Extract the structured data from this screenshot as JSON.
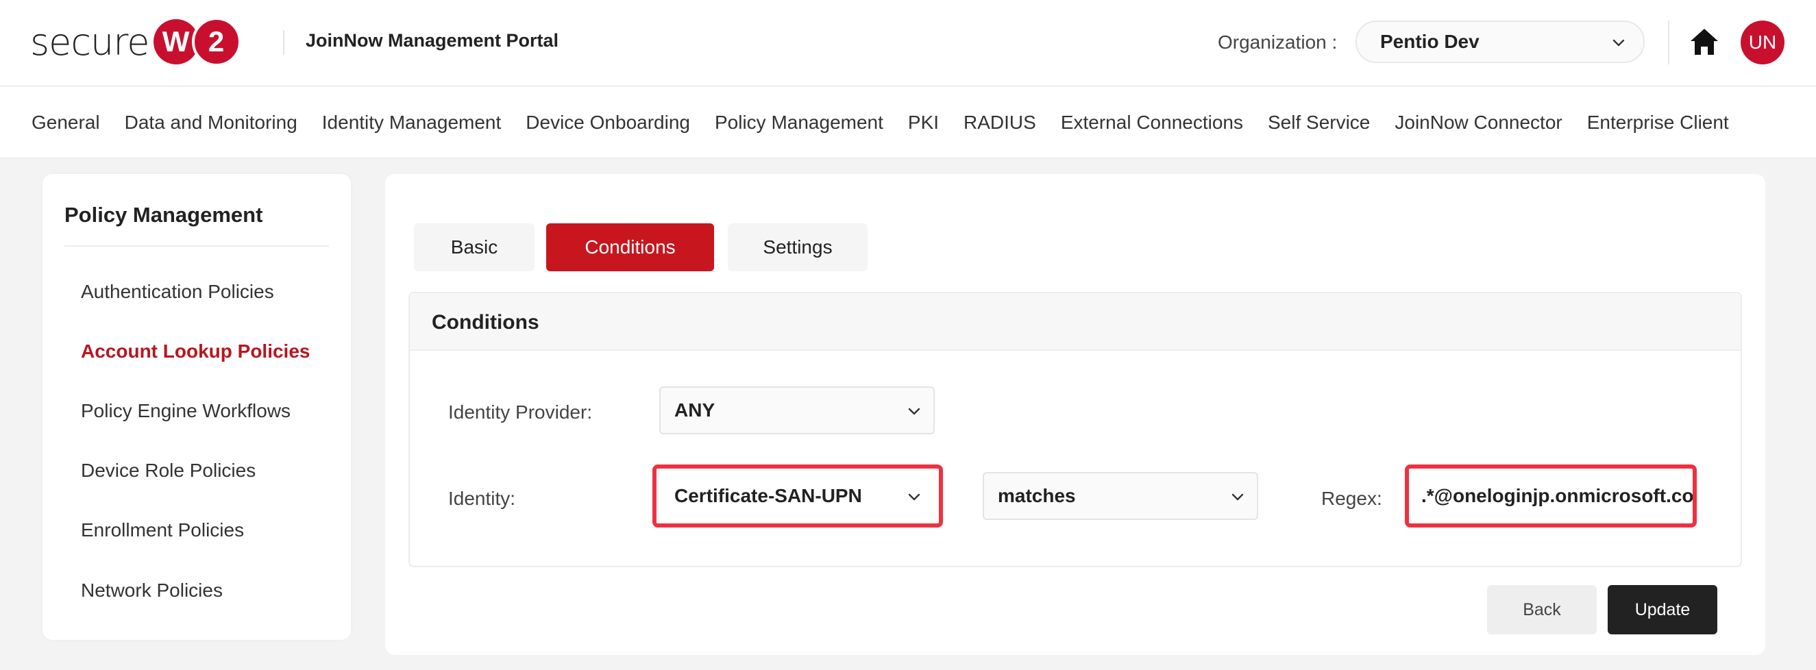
{
  "header": {
    "logo_text": "secure",
    "logo_badge_1": "W",
    "logo_badge_2": "2",
    "portal_title": "JoinNow Management Portal",
    "org_label": "Organization :",
    "org_value": "Pentio Dev",
    "avatar_initials": "UN"
  },
  "nav": {
    "items": [
      "General",
      "Data and Monitoring",
      "Identity Management",
      "Device Onboarding",
      "Policy Management",
      "PKI",
      "RADIUS",
      "External Connections",
      "Self Service",
      "JoinNow Connector",
      "Enterprise Client"
    ]
  },
  "sidebar": {
    "title": "Policy Management",
    "items": [
      "Authentication Policies",
      "Account Lookup Policies",
      "Policy Engine Workflows",
      "Device Role Policies",
      "Enrollment Policies",
      "Network Policies"
    ],
    "active_item": "Account Lookup Policies"
  },
  "tabs": [
    "Basic",
    "Conditions",
    "Settings"
  ],
  "active_tab": "Conditions",
  "conditions": {
    "title": "Conditions",
    "identity_provider_label": "Identity Provider:",
    "identity_provider_value": "ANY",
    "identity_label": "Identity:",
    "identity_value": "Certificate-SAN-UPN",
    "operator_value": "matches",
    "regex_label": "Regex:",
    "regex_value": ".*@oneloginjp.onmicrosoft.com"
  },
  "buttons": {
    "back": "Back",
    "update": "Update"
  },
  "colors": {
    "brand_red": "#c8102e",
    "active_tab": "#c8161e",
    "highlight": "#f0303f",
    "update_button": "#222222"
  }
}
